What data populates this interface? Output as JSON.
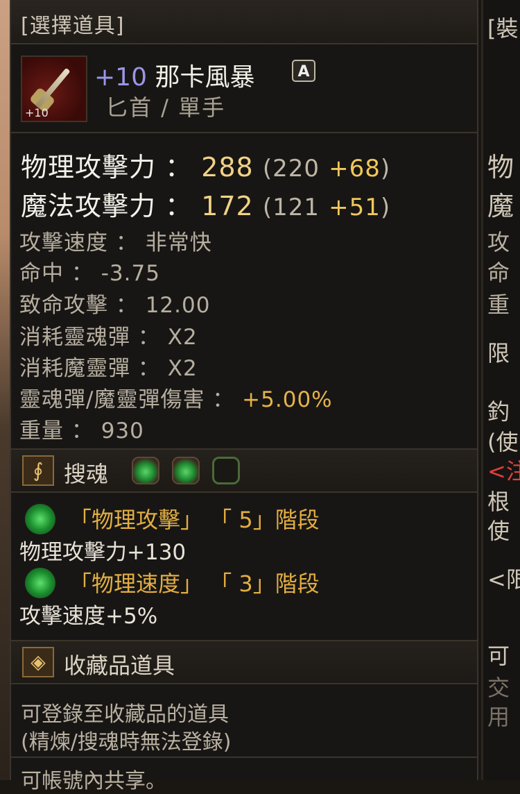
{
  "header": {
    "title": "[選擇道具]"
  },
  "item": {
    "enhance": "+10",
    "name": "那卡風暴",
    "grade_badge": "A",
    "type": "匕首 / 單手",
    "icon_level": "+10"
  },
  "main_stats": [
    {
      "label": "物理攻擊力 ：",
      "value": "288",
      "base": "(220",
      "bonus": "+68",
      "close": ")"
    },
    {
      "label": "魔法攻擊力 ：",
      "value": "172",
      "base": "(121",
      "bonus": "+51",
      "close": ")"
    }
  ],
  "sub_stats": [
    {
      "text": "攻擊速度 ： 非常快"
    },
    {
      "text": "命中 ： -3.75"
    },
    {
      "text": "致命攻擊 ： 12.00"
    },
    {
      "text": "消耗靈魂彈 ： X2"
    },
    {
      "text": "消耗魔靈彈 ： X2"
    },
    {
      "label": "靈魂彈/魔靈彈傷害 ：",
      "value": "+5.00%"
    },
    {
      "text": "重量 ： 930"
    }
  ],
  "soul_section": {
    "label": "搜魂",
    "slots": [
      "filled",
      "filled",
      "empty"
    ]
  },
  "soul_effects": [
    {
      "name": "「物理攻擊」",
      "stage": "「 5」階段",
      "effect": "物理攻擊力+130"
    },
    {
      "name": "「物理速度」",
      "stage": "「 3」階段",
      "effect": "攻擊速度+5%"
    }
  ],
  "collect_section": {
    "label": "收藏品道具",
    "desc1": "可登錄至收藏品的道具",
    "desc2": "(精煉/搜魂時無法登錄)",
    "desc3": "可帳號內共享。"
  },
  "right_panel": {
    "lines": [
      "[裝",
      "物",
      "魔",
      "攻",
      "命",
      "重",
      "限",
      "釣",
      "(使",
      "<注",
      "根",
      "使",
      "<限",
      "可",
      "交",
      "用"
    ]
  },
  "colors": {
    "gold": "#f0d288",
    "bonus": "#f0c85a",
    "enhance": "#9a96e6",
    "bg": "#181614"
  }
}
